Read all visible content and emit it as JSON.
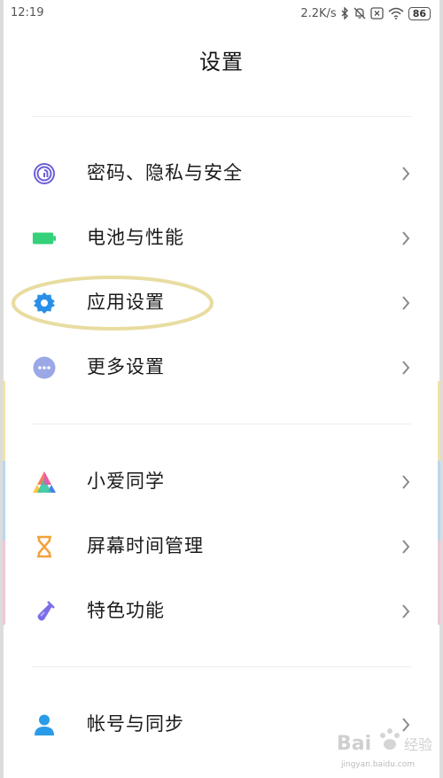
{
  "status_bar": {
    "time": "12:19",
    "network_speed": "2.2K/s",
    "battery_level": "86",
    "icons": [
      "bluetooth-icon",
      "mute-icon",
      "sim-x-icon",
      "wifi-icon",
      "battery-icon"
    ]
  },
  "header": {
    "title": "设置"
  },
  "sections": [
    {
      "items": [
        {
          "label": "密码、隐私与安全",
          "icon": "fingerprint-icon",
          "color": "#6b5fd8"
        },
        {
          "label": "电池与性能",
          "icon": "battery-icon",
          "color": "#34d07a"
        },
        {
          "label": "应用设置",
          "icon": "gear-icon",
          "color": "#2a8fe8"
        },
        {
          "label": "更多设置",
          "icon": "more-dots-icon",
          "color": "#9aa8e8"
        }
      ]
    },
    {
      "items": [
        {
          "label": "小爱同学",
          "icon": "xiaoai-icon",
          "color": "#4d7bf3"
        },
        {
          "label": "屏幕时间管理",
          "icon": "hourglass-icon",
          "color": "#f2a23a"
        },
        {
          "label": "特色功能",
          "icon": "test-tube-icon",
          "color": "#7a6ee8"
        }
      ]
    },
    {
      "items": [
        {
          "label": "帐号与同步",
          "icon": "person-icon",
          "color": "#2a9be8"
        }
      ]
    }
  ],
  "annotation": {
    "highlighted_item": "应用设置",
    "color": "#e8dca0"
  },
  "watermark": {
    "text": "Bai 经验",
    "url_text": "jingyan.baidu.com"
  }
}
